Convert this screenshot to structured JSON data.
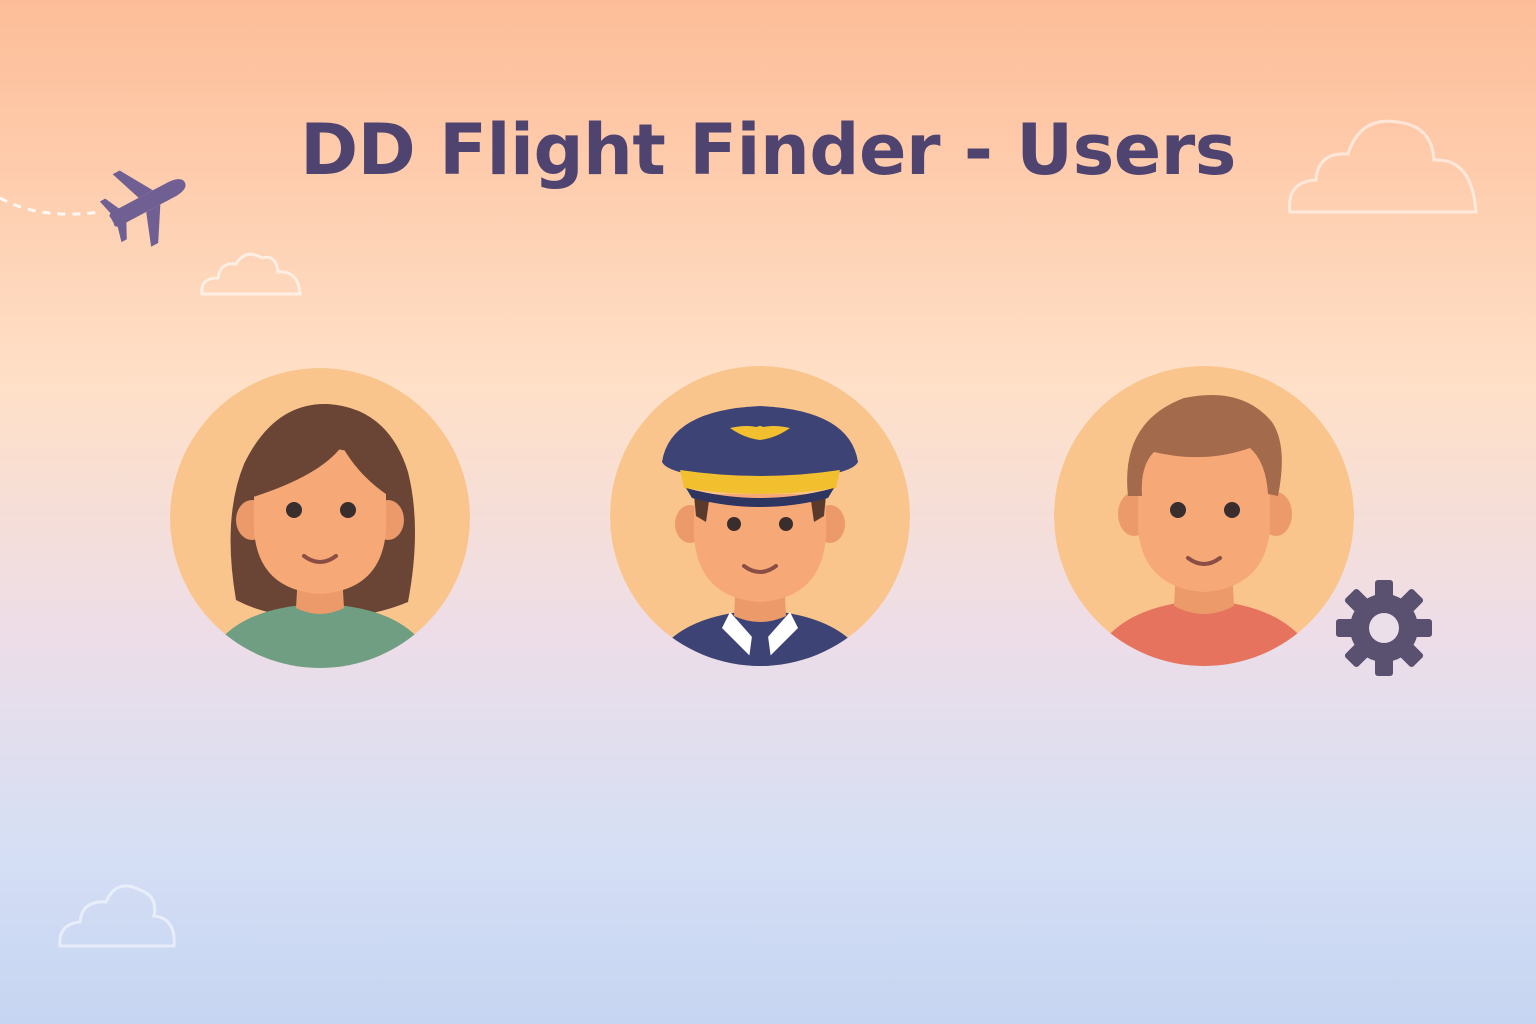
{
  "page": {
    "title": "DD Flight Finder - Users"
  },
  "users": [
    {
      "id": "traveler-woman",
      "icon": "woman-avatar",
      "shirt_color": "#6f9e83",
      "hair_color": "#6a4536"
    },
    {
      "id": "pilot",
      "icon": "pilot-avatar",
      "uniform_color": "#3d4475",
      "hat_band_color": "#f2c02e"
    },
    {
      "id": "traveler-man",
      "icon": "man-avatar",
      "shirt_color": "#e5735e",
      "hair_color": "#a36a4c"
    }
  ],
  "icons": {
    "airplane": "airplane-icon",
    "settings": "gear-icon",
    "clouds": "cloud-icon"
  },
  "colors": {
    "title": "#4f4470",
    "avatar_bg": "#f9c58d",
    "skin": "#f7a877",
    "accent": "#5a5070"
  }
}
